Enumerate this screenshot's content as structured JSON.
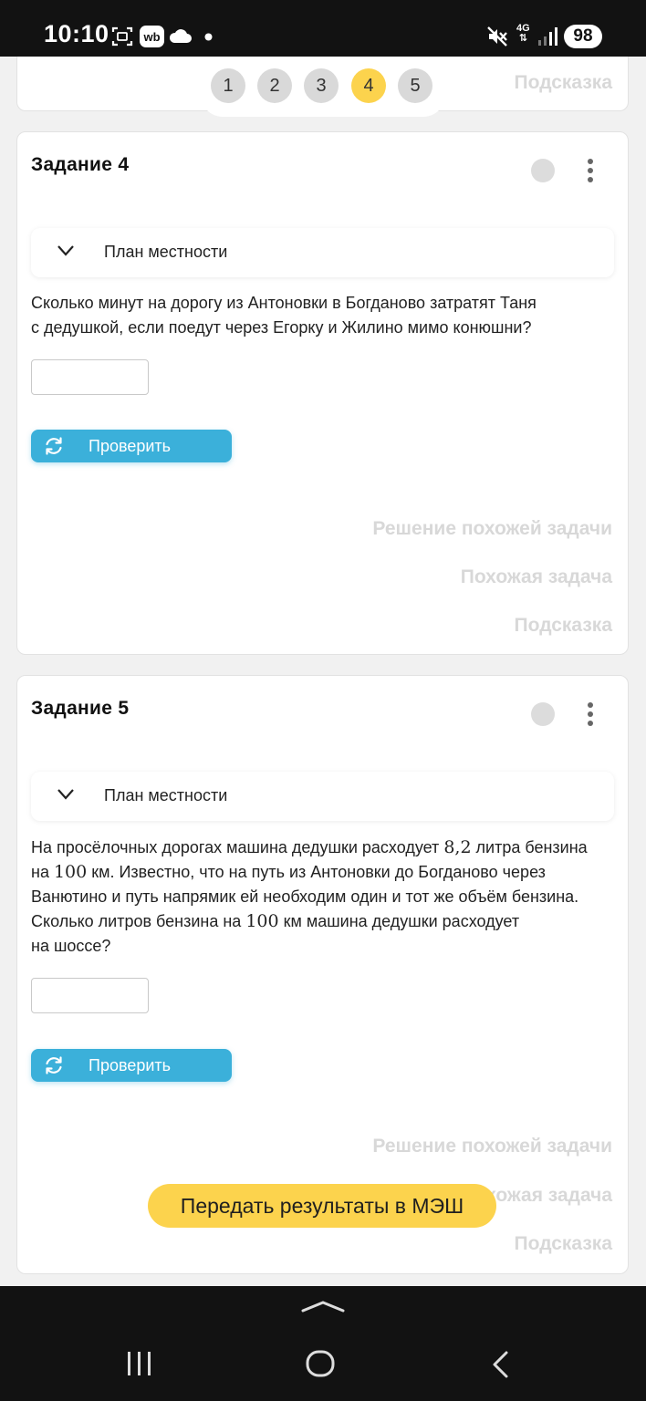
{
  "status_bar": {
    "time": "10:10",
    "icons": [
      "screenshot-icon",
      "wb-app-icon",
      "cloud-icon",
      "dot-icon",
      "mute-icon",
      "network-4g-icon",
      "signal-icon"
    ],
    "network": "4G",
    "battery": "98"
  },
  "pager": {
    "pages": [
      "1",
      "2",
      "3",
      "4",
      "5"
    ],
    "active": "4"
  },
  "top_card": {
    "hint_link": "Подсказка"
  },
  "task4": {
    "title": "Задание 4",
    "accordion_label": "План местности",
    "question_line1": "Сколько минут на дорогу из Антоновки в Богданово затратят Таня",
    "question_line2": "с дедушкой, если поедут через Егорку и Жилино мимо конюшни?",
    "answer_value": "",
    "check_label": "Проверить",
    "links": [
      "Решение похожей задачи",
      "Похожая задача",
      "Подсказка"
    ]
  },
  "task5": {
    "title": "Задание 5",
    "accordion_label": "План местности",
    "q_l1_a": "На просёлочных дорогах машина дедушки расходует ",
    "q_l1_num": "8,2",
    "q_l1_b": " литра бензина",
    "q_l2_a": "на ",
    "q_l2_num": "100",
    "q_l2_b": " км. Известно, что на путь из Антоновки до Богданово через",
    "q_l3": "Ванютино и путь напрямик ей необходим один и тот же объём бензина.",
    "q_l4_a": "Сколько литров бензина на ",
    "q_l4_num": "100",
    "q_l4_b": " км машина дедушки расходует",
    "q_l5": "на шоссе?",
    "answer_value": "",
    "check_label": "Проверить",
    "links": [
      "Решение похожей задачи",
      "Похожая задача",
      "Подсказка"
    ]
  },
  "submit_button": "Передать результаты в МЭШ",
  "nav_bar": {
    "icons": [
      "chevron-up-icon",
      "recent-apps-icon",
      "home-icon",
      "back-icon"
    ]
  },
  "colors": {
    "accent_blue": "#3bb0da",
    "accent_yellow": "#fcd34d",
    "muted_link": "#d8d8d8"
  }
}
